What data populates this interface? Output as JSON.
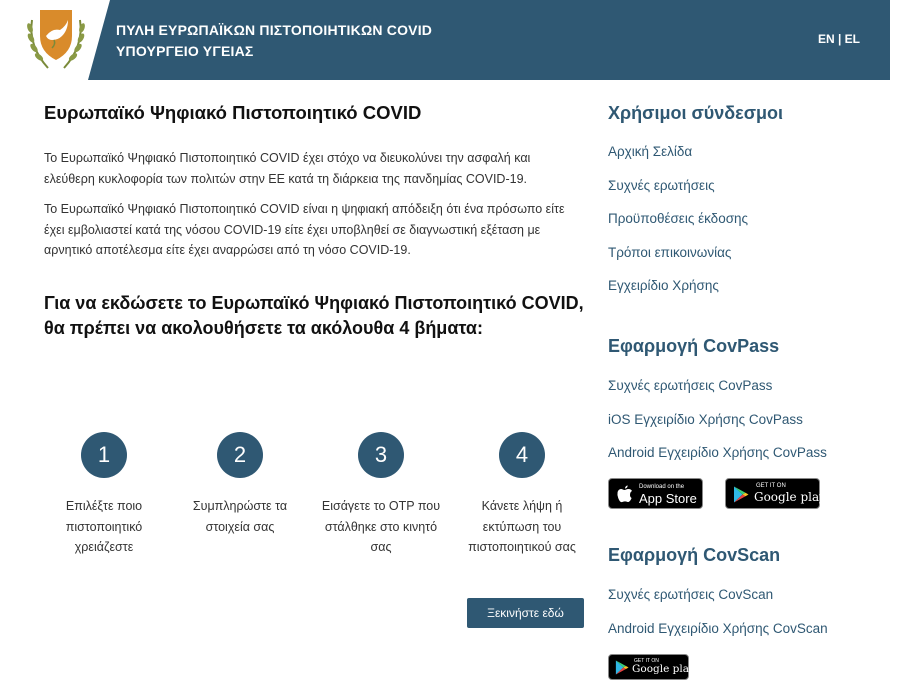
{
  "header": {
    "title_line1": "ΠΥΛΗ ΕΥΡΩΠΑΪΚΩΝ ΠΙΣΤΟΠΟΙΗΤΙΚΩΝ COVID",
    "title_line2": "ΥΠΟΥΡΓΕΙΟ ΥΓΕΙΑΣ",
    "lang_en": "EN",
    "lang_sep": " | ",
    "lang_el": "EL",
    "colors": {
      "bar": "#2f5873",
      "text": "#ffffff"
    }
  },
  "main": {
    "heading": "Ευρωπαϊκό Ψηφιακό Πιστοποιητικό COVID",
    "para1": "Το Ευρωπαϊκό Ψηφιακό Πιστοποιητικό COVID έχει στόχο να διευκολύνει την ασφαλή και ελεύθερη κυκλοφορία των πολιτών στην ΕΕ κατά τη διάρκεια της πανδημίας COVID-19.",
    "para2": "Το Ευρωπαϊκό Ψηφιακό Πιστοποιητικό COVID είναι η ψηφιακή απόδειξη ότι ένα πρόσωπο είτε έχει εμβολιαστεί κατά της νόσου COVID-19 είτε έχει υποβληθεί σε διαγνωστική εξέταση με αρνητικό αποτέλεσμα είτε έχει αναρρώσει από τη νόσο COVID-19.",
    "steps_heading": "Για να εκδώσετε το Ευρωπαϊκό Ψηφιακό Πιστοποιητικό COVID, θα πρέπει να ακολουθήσετε τα ακόλουθα 4 βήματα:",
    "steps": [
      {
        "number": "1",
        "label": "Επιλέξτε ποιο πιστοποιητικό χρειάζεστε"
      },
      {
        "number": "2",
        "label": "Συμπληρώστε τα στοιχεία σας"
      },
      {
        "number": "3",
        "label": "Εισάγετε το OTP που στάλθηκε στο κινητό σας"
      },
      {
        "number": "4",
        "label": "Κάνετε λήψη ή εκτύπωση του πιστοποιητικού σας"
      }
    ],
    "start_button": "Ξεκινήστε εδώ"
  },
  "sidebar": {
    "useful_links": {
      "heading": "Χρήσιμοι σύνδεσμοι",
      "items": [
        "Αρχική Σελίδα",
        "Συχνές ερωτήσεις",
        "Προϋποθέσεις έκδοσης",
        "Τρόποι επικοινωνίας",
        "Εγχειρίδιο Χρήσης"
      ]
    },
    "covpass": {
      "heading": "Εφαρμογή CovPass",
      "items": [
        "Συχνές ερωτήσεις CovPass",
        "iOS Εγχειρίδιο Χρήσης CovPass",
        "Android Εγχειρίδιο Χρήσης CovPass"
      ]
    },
    "covscan": {
      "heading": "Εφαρμογή CovScan",
      "items": [
        "Συχνές ερωτήσεις CovScan",
        "Android Εγχειρίδιο Χρήσης CovScan"
      ]
    },
    "badges": {
      "appstore_small": "Download on the",
      "appstore_big": "App Store",
      "gplay_small": "GET IT ON",
      "gplay_big": "Google play"
    }
  }
}
